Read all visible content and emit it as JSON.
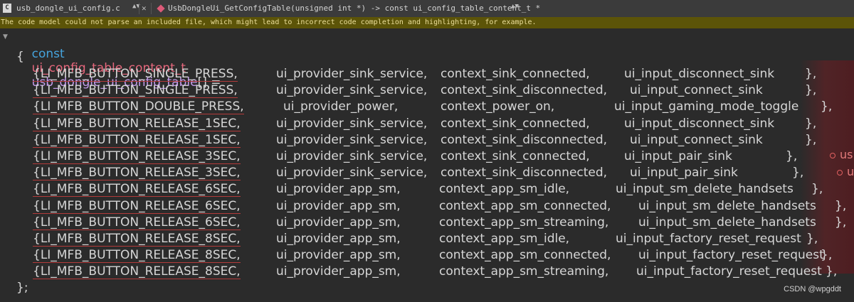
{
  "toolbar": {
    "file_icon_letter": "C",
    "file_name": "usb_dongle_ui_config.c",
    "function_signature": "UsbDongleUi_GetConfigTable(unsigned int *) -> const ui_config_table_content_t *"
  },
  "warning": "The code model could not parse an included file, which might lead to incorrect code completion and highlighting, for example.",
  "code": {
    "decl_keyword": "const",
    "decl_type": "ui_config_table_content_t",
    "decl_name": "usb_dongle_ui_config_table",
    "decl_suffix": "[] =",
    "open_brace": "{",
    "close_brace": "};",
    "rows": [
      {
        "c1": "{LI_MFB_BUTTON_SINGLE_PRESS,",
        "c2": "ui_provider_sink_service,",
        "c3": "context_sink_connected,",
        "c4": "ui_input_disconnect_sink",
        "c5": "},"
      },
      {
        "c1": "{LI_MFB_BUTTON_SINGLE_PRESS,",
        "c2": "ui_provider_sink_service,",
        "c3": "context_sink_disconnected,",
        "c4": "ui_input_connect_sink",
        "c5": "},"
      },
      {
        "c1": "{LI_MFB_BUTTON_DOUBLE_PRESS,",
        "c2": "ui_provider_power,",
        "c3": "context_power_on,",
        "c4": "ui_input_gaming_mode_toggle",
        "c5": "},"
      },
      {
        "c1": "{LI_MFB_BUTTON_RELEASE_1SEC,",
        "c2": "ui_provider_sink_service,",
        "c3": "context_sink_connected,",
        "c4": "ui_input_disconnect_sink",
        "c5": "},"
      },
      {
        "c1": "{LI_MFB_BUTTON_RELEASE_1SEC,",
        "c2": "ui_provider_sink_service,",
        "c3": "context_sink_disconnected,",
        "c4": "ui_input_connect_sink",
        "c5": "},"
      },
      {
        "c1": "{LI_MFB_BUTTON_RELEASE_3SEC,",
        "c2": "ui_provider_sink_service,",
        "c3": "context_sink_connected,",
        "c4": "ui_input_pair_sink",
        "c5": "},"
      },
      {
        "c1": "{LI_MFB_BUTTON_RELEASE_3SEC,",
        "c2": "ui_provider_sink_service,",
        "c3": "context_sink_disconnected,",
        "c4": "ui_input_pair_sink",
        "c5": "},"
      },
      {
        "c1": "{LI_MFB_BUTTON_RELEASE_6SEC,",
        "c2": "ui_provider_app_sm,",
        "c3": "context_app_sm_idle,",
        "c4": "ui_input_sm_delete_handsets",
        "c5": "},"
      },
      {
        "c1": "{LI_MFB_BUTTON_RELEASE_6SEC,",
        "c2": "ui_provider_app_sm,",
        "c3": "context_app_sm_connected,",
        "c4": "ui_input_sm_delete_handsets",
        "c5": "},"
      },
      {
        "c1": "{LI_MFB_BUTTON_RELEASE_6SEC,",
        "c2": "ui_provider_app_sm,",
        "c3": "context_app_sm_streaming,",
        "c4": "ui_input_sm_delete_handsets",
        "c5": "},"
      },
      {
        "c1": "{LI_MFB_BUTTON_RELEASE_8SEC,",
        "c2": "ui_provider_app_sm,",
        "c3": "context_app_sm_idle,",
        "c4": "ui_input_factory_reset_request",
        "c5": "},"
      },
      {
        "c1": "{LI_MFB_BUTTON_RELEASE_8SEC,",
        "c2": "ui_provider_app_sm,",
        "c3": "context_app_sm_connected,",
        "c4": "ui_input_factory_reset_request",
        "c5": "},"
      },
      {
        "c1": "{LI_MFB_BUTTON_RELEASE_8SEC,",
        "c2": "ui_provider_app_sm,",
        "c3": "context_app_sm_streaming,",
        "c4": "ui_input_factory_reset_request",
        "c5": "},"
      }
    ],
    "annotations": {
      "row6": "us",
      "row7": "u"
    }
  },
  "watermark": "CSDN @wpgddt",
  "colors": {
    "background": "#2b2b2b",
    "keyword": "#45a3dc",
    "type": "#e6677c",
    "variable": "#c49cec",
    "warning_bg": "#5c5408"
  }
}
